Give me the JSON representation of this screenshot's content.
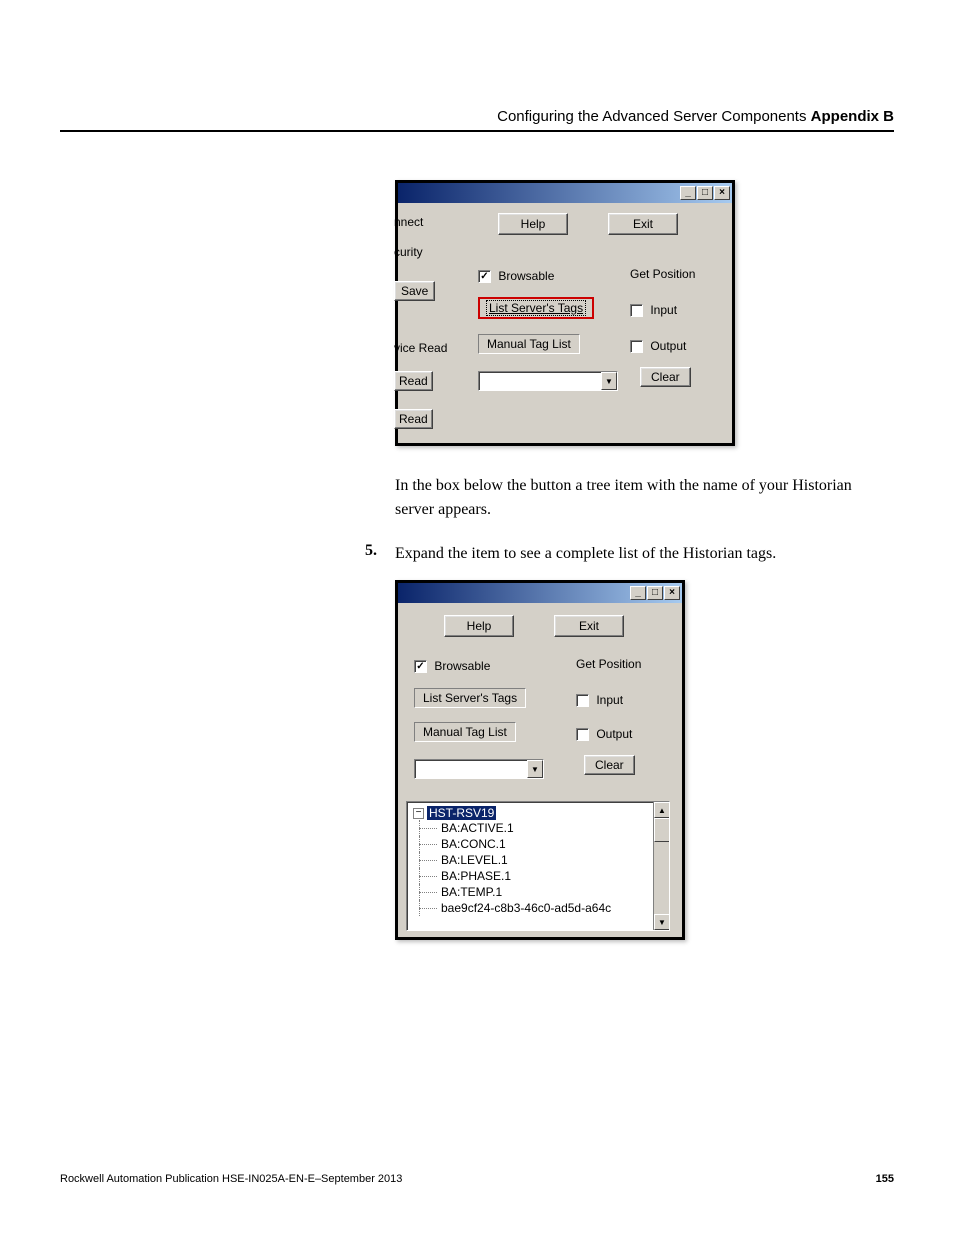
{
  "header": {
    "section": "Configuring the Advanced Server Components",
    "appendix": "Appendix B"
  },
  "figure1": {
    "left_fragments": {
      "nnect": "nnect",
      "curity": "curity",
      "save": "Save",
      "vice_read": "vice Read",
      "read1": "Read",
      "read2": "Read"
    },
    "help": "Help",
    "exit": "Exit",
    "browsable": "Browsable",
    "get_position": "Get Position",
    "list_servers_tags": "List Server's Tags",
    "input": "Input",
    "manual_tag_list": "Manual Tag List",
    "output": "Output",
    "clear": "Clear",
    "titlebar": {
      "min": "_",
      "max": "□",
      "close": "×"
    }
  },
  "para1": "In the box below the button a tree item with the name of your Historian server appears.",
  "step5": {
    "num": "5.",
    "text": "Expand the item to see a complete list of the Historian tags."
  },
  "figure2": {
    "help": "Help",
    "exit": "Exit",
    "browsable": "Browsable",
    "get_position": "Get Position",
    "list_servers_tags": "List Server's Tags",
    "input": "Input",
    "manual_tag_list": "Manual Tag List",
    "output": "Output",
    "clear": "Clear",
    "titlebar": {
      "min": "_",
      "max": "□",
      "close": "×"
    },
    "tree": {
      "root": "HST-RSV19",
      "children": [
        "BA:ACTIVE.1",
        "BA:CONC.1",
        "BA:LEVEL.1",
        "BA:PHASE.1",
        "BA:TEMP.1",
        "bae9cf24-c8b3-46c0-ad5d-a64c"
      ]
    }
  },
  "footer": {
    "pub": "Rockwell Automation Publication HSE-IN025A-EN-E–September 2013",
    "page": "155"
  }
}
